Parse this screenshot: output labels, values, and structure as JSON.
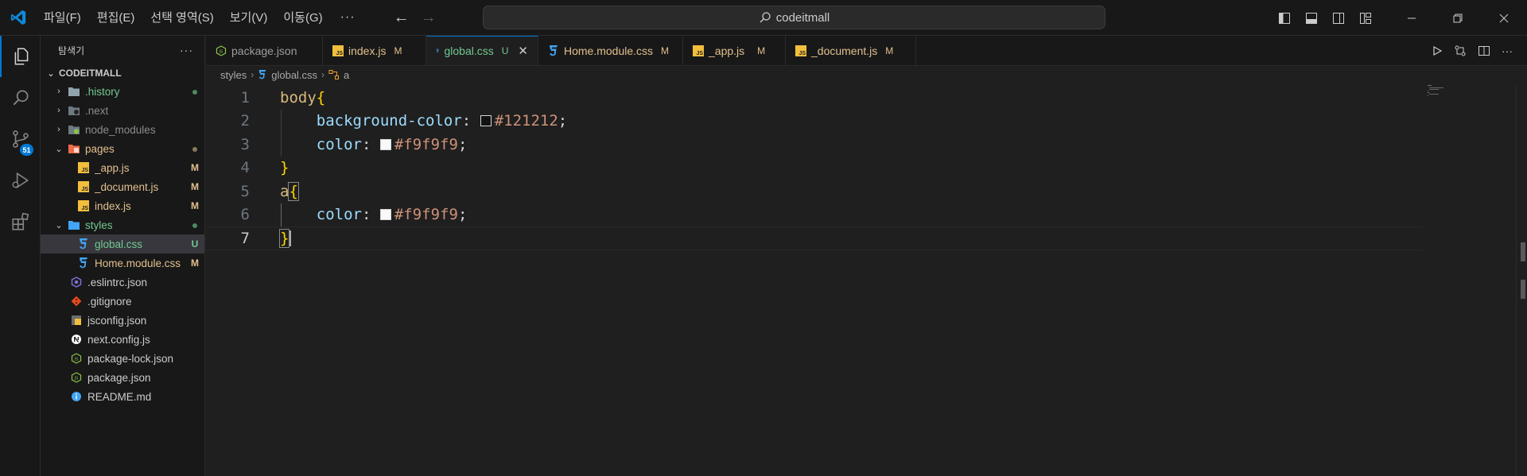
{
  "titlebar": {
    "menu": [
      "파일(F)",
      "편집(E)",
      "선택 영역(S)",
      "보기(V)",
      "이동(G)"
    ],
    "more": "···",
    "search": "codeitmall"
  },
  "activity": {
    "scm_badge": "51"
  },
  "sidebar": {
    "title": "탐색기",
    "more": "···",
    "root": "CODEITMALL",
    "items": [
      {
        "name": ".history",
        "status": "dot"
      },
      {
        "name": ".next",
        "status": ""
      },
      {
        "name": "node_modules",
        "status": ""
      },
      {
        "name": "pages",
        "status": "dot"
      },
      {
        "name": "_app.js",
        "status": "M"
      },
      {
        "name": "_document.js",
        "status": "M"
      },
      {
        "name": "index.js",
        "status": "M"
      },
      {
        "name": "styles",
        "status": "dot"
      },
      {
        "name": "global.css",
        "status": "U"
      },
      {
        "name": "Home.module.css",
        "status": "M"
      },
      {
        "name": ".eslintrc.json",
        "status": ""
      },
      {
        "name": ".gitignore",
        "status": ""
      },
      {
        "name": "jsconfig.json",
        "status": ""
      },
      {
        "name": "next.config.js",
        "status": ""
      },
      {
        "name": "package-lock.json",
        "status": ""
      },
      {
        "name": "package.json",
        "status": ""
      },
      {
        "name": "README.md",
        "status": ""
      }
    ]
  },
  "tabs": [
    {
      "label": "package.json",
      "status": ""
    },
    {
      "label": "index.js",
      "status": "M"
    },
    {
      "label": "global.css",
      "status": "U"
    },
    {
      "label": "Home.module.css",
      "status": "M"
    },
    {
      "label": "_app.js",
      "status": "M"
    },
    {
      "label": "_document.js",
      "status": "M"
    }
  ],
  "breadcrumb": [
    "styles",
    "global.css",
    "a"
  ],
  "code": {
    "line_numbers": [
      "1",
      "2",
      "3",
      "4",
      "5",
      "6",
      "7"
    ],
    "l1_sel": "body",
    "l1_brace": "{",
    "l2_prop": "background-color",
    "l2_colon": ": ",
    "l2_val": "#121212",
    "l2_semi": ";",
    "l3_prop": "color",
    "l3_colon": ": ",
    "l3_val": "#f9f9f9",
    "l3_semi": ";",
    "l4_brace": "}",
    "l5_sel": "a",
    "l5_brace": "{",
    "l6_prop": "color",
    "l6_colon": ": ",
    "l6_val": "#f9f9f9",
    "l6_semi": ";",
    "l7_brace": "}"
  },
  "colors": {
    "accent": "#0078d4",
    "modified": "#e2c08d",
    "untracked": "#73c991",
    "swatch_dark": "#121212",
    "swatch_light": "#f9f9f9"
  }
}
